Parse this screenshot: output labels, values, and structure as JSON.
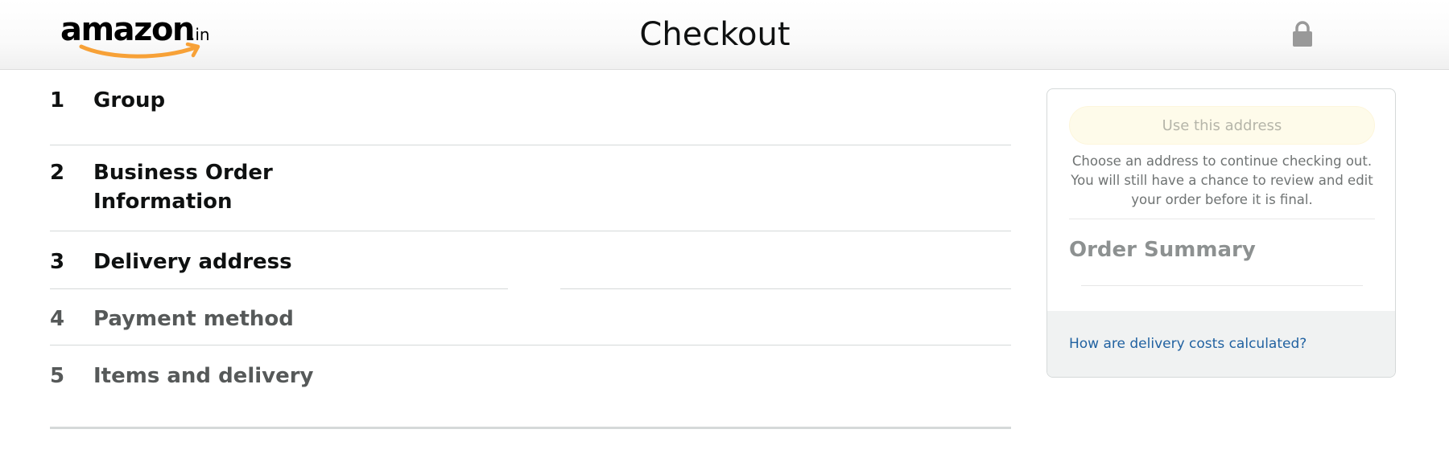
{
  "header": {
    "logo_text": "amazon",
    "logo_tld": ".in",
    "title": "Checkout",
    "lock_icon": "lock-icon"
  },
  "steps": [
    {
      "number": "1",
      "title": "Group",
      "state": "active"
    },
    {
      "number": "2",
      "title": "Business Order Information",
      "state": "active"
    },
    {
      "number": "3",
      "title": "Delivery address",
      "state": "active"
    },
    {
      "number": "4",
      "title": "Payment method",
      "state": "inactive"
    },
    {
      "number": "5",
      "title": "Items and delivery",
      "state": "inactive"
    }
  ],
  "summary": {
    "use_address_label": "Use this address",
    "help_text": "Choose an address to continue checking out. You will still have a chance to review and edit your order before it is final.",
    "order_summary_title": "Order Summary",
    "delivery_costs_link": "How are delivery costs calculated?"
  },
  "colors": {
    "logo_smile": "#f7a137",
    "link": "#2162a1",
    "button_disabled_bg": "#fefbea",
    "muted_text": "#565959"
  }
}
